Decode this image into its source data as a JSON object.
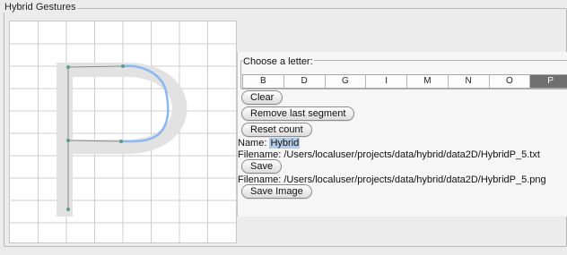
{
  "panel": {
    "title": "Hybrid Gestures"
  },
  "letter_chooser": {
    "title": "Choose a letter:",
    "letters": [
      "B",
      "D",
      "G",
      "I",
      "M",
      "N",
      "O",
      "P"
    ],
    "selected": "P"
  },
  "buttons": {
    "clear": "Clear",
    "remove_last_segment": "Remove last segment",
    "reset_count": "Reset count",
    "save": "Save",
    "save_image": "Save Image"
  },
  "name": {
    "label": "Name:",
    "value": "Hybrid"
  },
  "filename_txt": {
    "label": "Filename:",
    "value": "/Users/localuser/projects/data/hybrid/data2D/HybridP_5.txt"
  },
  "filename_png": {
    "label": "Filename:",
    "value": "/Users/localuser/projects/data/hybrid/data2D/HybridP_5.png"
  },
  "colors": {
    "stroke": "#8ab8f0",
    "template_letter": "#e2e2e2",
    "points": "#5e9e86",
    "grid": "#cfcfcf",
    "selected_letter_bg": "#6f6f6f",
    "name_highlight": "#b6cde8"
  },
  "icons": {
    "gesture_point": "dot"
  }
}
